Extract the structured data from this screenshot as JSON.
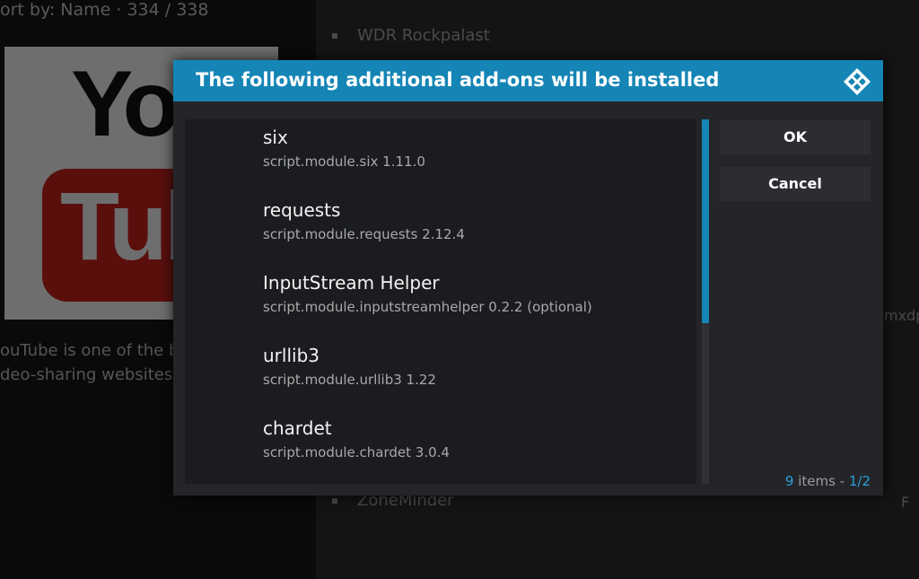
{
  "background": {
    "sort_text": "ort by: Name  ·  334 / 338",
    "thumbnail": {
      "you": "You",
      "tube": "Tub"
    },
    "description_lines": [
      "ouTube is one of the b",
      "deo-sharing websites"
    ],
    "list_items": [
      "WDR Rockpalast",
      "ZoneMinder"
    ],
    "right_clips": [
      "mxdp",
      "F"
    ]
  },
  "dialog": {
    "title": "The following additional add-ons will be installed",
    "accent_color": "#1585b5",
    "items": [
      {
        "name": "six",
        "info": "script.module.six 1.11.0"
      },
      {
        "name": "requests",
        "info": "script.module.requests 2.12.4"
      },
      {
        "name": "InputStream Helper",
        "info": "script.module.inputstreamhelper 0.2.2 (optional)"
      },
      {
        "name": "urllib3",
        "info": "script.module.urllib3 1.22"
      },
      {
        "name": "chardet",
        "info": "script.module.chardet 3.0.4"
      }
    ],
    "buttons": {
      "ok": "OK",
      "cancel": "Cancel"
    },
    "count": {
      "number": "9",
      "label": "items",
      "separator": " - ",
      "page": "1/2"
    },
    "scroll_fraction_visible": 0.56,
    "logo_icon": "kodi-logo-icon"
  }
}
